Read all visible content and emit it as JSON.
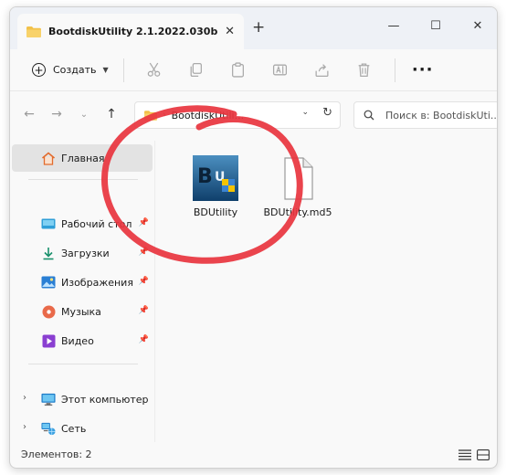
{
  "window": {
    "tab_title": "BootdiskUtility 2.1.2022.030b",
    "tab_close": "✕",
    "new_tab": "+",
    "controls": {
      "minimize": "—",
      "maximize": "☐",
      "close": "✕"
    }
  },
  "toolbar": {
    "new_label": "Создать",
    "more_label": "···"
  },
  "address": {
    "path": "BootdiskUtili...",
    "search_placeholder": "Поиск в: BootdiskUti..."
  },
  "sidebar": {
    "items": [
      {
        "label": "Главная"
      },
      {
        "label": "Рабочий стол"
      },
      {
        "label": "Загрузки"
      },
      {
        "label": "Изображения"
      },
      {
        "label": "Музыка"
      },
      {
        "label": "Видео"
      },
      {
        "label": "Этот компьютер"
      },
      {
        "label": "Сеть"
      }
    ]
  },
  "files": [
    {
      "name": "BDUtility",
      "icon": "bdutility-app-icon"
    },
    {
      "name": "BDUtility.md5",
      "icon": "blank-file-icon"
    }
  ],
  "status": {
    "items_count": "Элементов: 2"
  },
  "colors": {
    "accent": "#0067c0",
    "marker": "#e8343e",
    "folder": "#f2c14a"
  }
}
